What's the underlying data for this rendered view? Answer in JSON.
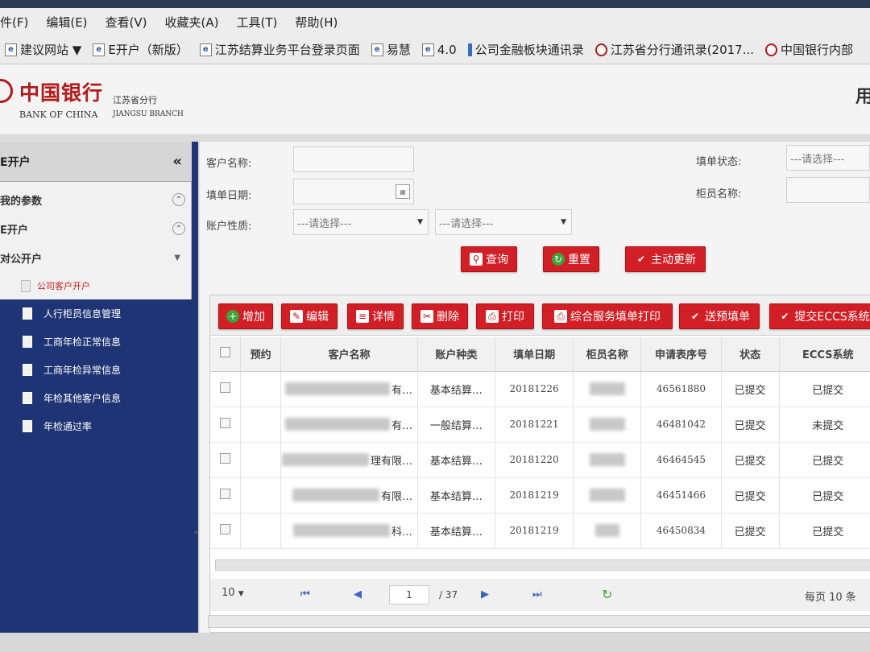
{
  "browser": {
    "menu": [
      "件(F)",
      "编辑(E)",
      "查看(V)",
      "收藏夹(A)",
      "工具(T)",
      "帮助(H)"
    ],
    "favorites": [
      {
        "label": "建议网站 ▼",
        "icon": "e"
      },
      {
        "label": "E开户（新版）",
        "icon": "e"
      },
      {
        "label": "江苏结算业务平台登录页面",
        "icon": "e"
      },
      {
        "label": "易慧",
        "icon": "e"
      },
      {
        "label": "4.0",
        "icon": "e"
      },
      {
        "label": "公司金融板块通讯录",
        "icon": "bar"
      },
      {
        "label": "江苏省分行通讯录(2017...",
        "icon": "bank"
      },
      {
        "label": "中国银行内部",
        "icon": "bank"
      }
    ]
  },
  "header": {
    "bank_cn": "中国银行",
    "bank_en": "BANK OF CHINA",
    "branch_cn": "江苏省分行",
    "branch_en": "JIANGSU BRANCH",
    "user": "用"
  },
  "sidebar": {
    "title": "E开户",
    "collapse": "«",
    "groups": [
      "我的参数",
      "E开户",
      "对公开户"
    ],
    "active_item": "公司客户开户",
    "items": [
      "人行柜员信息管理",
      "工商年检正常信息",
      "工商年检异常信息",
      "年检其他客户信息",
      "年检通过率"
    ]
  },
  "search": {
    "customer_name_label": "客户名称:",
    "fill_date_label": "填单日期:",
    "account_nature_label": "账户性质:",
    "fill_status_label": "填单状态:",
    "teller_name_label": "柜员名称:",
    "select_placeholder": "---请选择---",
    "query_btn": "查询",
    "reset_btn": "重置",
    "refresh_btn": "主动更新"
  },
  "toolbar": {
    "add": "增加",
    "edit": "编辑",
    "detail": "详情",
    "delete": "删除",
    "print": "打印",
    "service_print": "综合服务填单打印",
    "send_prefill": "送预填单",
    "submit_eccs": "提交ECCS系统"
  },
  "table": {
    "columns": [
      "预约",
      "客户名称",
      "账户种类",
      "填单日期",
      "柜员名称",
      "申请表序号",
      "状态",
      "ECCS系统"
    ],
    "rows": [
      {
        "name_tail": "有…",
        "account_type": "基本结算…",
        "date": "20181226",
        "serial": "46561880",
        "status": "已提交",
        "eccs": "已提交"
      },
      {
        "name_tail": "有…",
        "account_type": "一般结算…",
        "date": "20181221",
        "serial": "46481042",
        "status": "已提交",
        "eccs": "未提交"
      },
      {
        "name_tail": "理有限…",
        "account_type": "基本结算…",
        "date": "20181220",
        "serial": "46464545",
        "status": "已提交",
        "eccs": "已提交"
      },
      {
        "name_tail": "有限…",
        "account_type": "基本结算…",
        "date": "20181219",
        "serial": "46451466",
        "status": "已提交",
        "eccs": "已提交"
      },
      {
        "name_tail": "科…",
        "account_type": "基本结算…",
        "date": "20181219",
        "serial": "46450834",
        "status": "已提交",
        "eccs": "已提交"
      }
    ]
  },
  "pager": {
    "page_size": "10",
    "current_page": "1",
    "total_pages": "/ 37",
    "per_page_text": "每页 10 条"
  },
  "colors": {
    "brand_red": "#d21f26",
    "sidebar_blue": "#1f3474"
  }
}
